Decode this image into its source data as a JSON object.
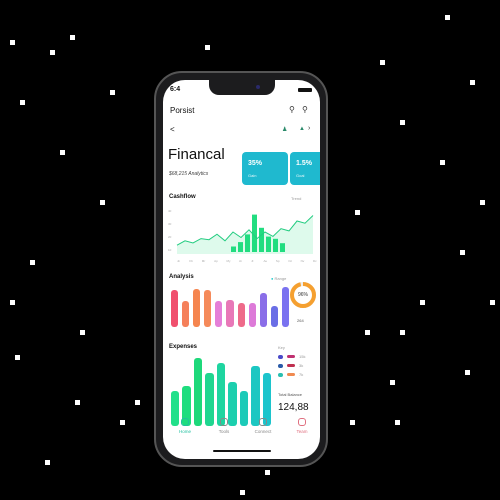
{
  "status": {
    "time": "6:4"
  },
  "header": {
    "title": "Porsist",
    "back": "<"
  },
  "hero": {
    "title": "Financal",
    "subtitle": "$68,215 Analytics"
  },
  "cards": [
    {
      "value": "35%",
      "label": "Gain"
    },
    {
      "value": "1.5%",
      "label": "Goal"
    }
  ],
  "cashflow": {
    "title": "Cashflow",
    "action": "Trend",
    "y_ticks": [
      "40",
      "30",
      "20",
      "10"
    ],
    "x_ticks": [
      "Jn",
      "Fb",
      "Mr",
      "Ap",
      "My",
      "Jn",
      "Jl",
      "Au",
      "Sp",
      "Oc",
      "Nv",
      "Dc"
    ],
    "line": [
      8,
      12,
      10,
      14,
      13,
      18,
      12,
      20,
      15,
      22,
      14,
      20,
      16,
      23,
      21,
      30,
      28,
      35
    ],
    "bars": [
      5,
      9,
      16,
      34,
      22,
      14,
      12,
      8
    ]
  },
  "analysis": {
    "title": "Analysis",
    "legend": "Range",
    "bars": [
      {
        "v": 80,
        "c": "#f0506e"
      },
      {
        "v": 55,
        "c": "#f5805a"
      },
      {
        "v": 82,
        "c": "#f5854f"
      },
      {
        "v": 80,
        "c": "#f58a5a"
      },
      {
        "v": 55,
        "c": "#e57fd8"
      },
      {
        "v": 58,
        "c": "#e878b8"
      },
      {
        "v": 52,
        "c": "#ee6a8a"
      },
      {
        "v": 52,
        "c": "#dd7ad8"
      },
      {
        "v": 72,
        "c": "#8a6ee8"
      },
      {
        "v": 45,
        "c": "#6a6ee6"
      },
      {
        "v": 85,
        "c": "#7a72f0"
      }
    ],
    "donut": {
      "value": "96%",
      "percent": 96,
      "sub": "264"
    }
  },
  "expenses": {
    "title": "Expenses",
    "bars": [
      {
        "v": 48,
        "c": "#22e08a"
      },
      {
        "v": 54,
        "c": "#1fdd7e"
      },
      {
        "v": 92,
        "c": "#1ed87a"
      },
      {
        "v": 72,
        "c": "#20d690"
      },
      {
        "v": 86,
        "c": "#1ed5a0"
      },
      {
        "v": 60,
        "c": "#1ccfae"
      },
      {
        "v": 48,
        "c": "#1ccab8"
      },
      {
        "v": 82,
        "c": "#1cc7c2"
      },
      {
        "v": 72,
        "c": "#1cc4cc"
      }
    ],
    "legend_title": "Key",
    "legend": [
      {
        "label": "15k",
        "c1": "#4a4ac8",
        "c2": "#c03070"
      },
      {
        "label": "3k",
        "c1": "#2a5aa8",
        "c2": "#c03050"
      },
      {
        "label": "7k",
        "c1": "#2abfb0",
        "c2": "#f08a50"
      }
    ],
    "total_label": "Total Balance",
    "total": "124,88"
  },
  "nav": [
    {
      "label": "Home",
      "active": true
    },
    {
      "label": "Tools"
    },
    {
      "label": "Connect"
    },
    {
      "label": "Team"
    }
  ],
  "colors": {
    "accent": "#1fb9cf",
    "green": "#22e08a"
  }
}
